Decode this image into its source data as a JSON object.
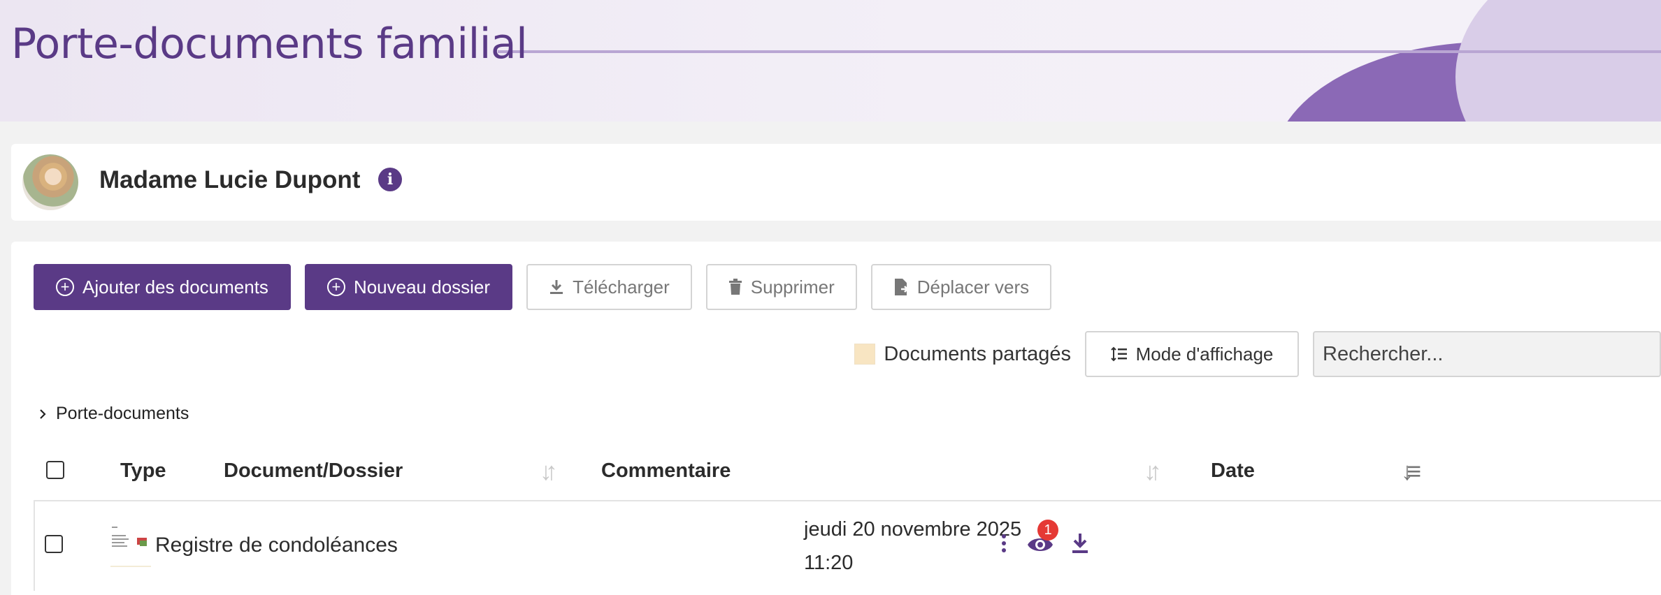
{
  "header": {
    "title": "Porte-documents familial"
  },
  "person": {
    "name": "Madame Lucie Dupont",
    "info_icon": "info-icon"
  },
  "toolbar": {
    "add_documents": "Ajouter des documents",
    "new_folder": "Nouveau dossier",
    "download": "Télécharger",
    "delete": "Supprimer",
    "move_to": "Déplacer vers"
  },
  "filters": {
    "shared_legend": "Documents partagés",
    "shared_color": "#f8e5c2",
    "view_mode": "Mode d'affichage",
    "search_placeholder": "Rechercher..."
  },
  "breadcrumb": {
    "root": "Porte-documents"
  },
  "table": {
    "columns": {
      "type": "Type",
      "document": "Document/Dossier",
      "comment": "Commentaire",
      "date": "Date"
    },
    "rows": [
      {
        "document": "Registre de condoléances",
        "comment": "",
        "date_line1": "jeudi 20 novembre 2025",
        "date_line2": "11:20",
        "views_badge": "1"
      }
    ]
  },
  "colors": {
    "brand": "#5a3a86",
    "accent": "#8b69b6",
    "badge": "#e53935"
  }
}
